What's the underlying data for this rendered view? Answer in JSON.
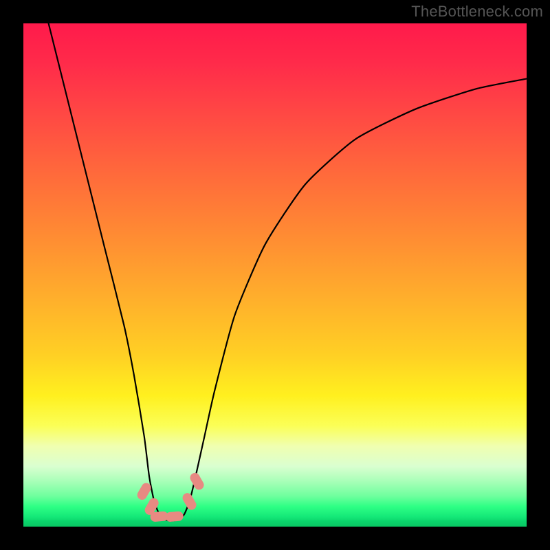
{
  "watermark": "TheBottleneck.com",
  "chart_data": {
    "type": "line",
    "title": "",
    "xlabel": "",
    "ylabel": "",
    "xlim": [
      0,
      100
    ],
    "ylim": [
      0,
      100
    ],
    "grid": false,
    "legend": false,
    "series": [
      {
        "name": "curve",
        "x": [
          5,
          8,
          12,
          16,
          20,
          22,
          24,
          25,
          26,
          27,
          28,
          29,
          30,
          31,
          32,
          33,
          34,
          36,
          38,
          42,
          48,
          56,
          66,
          78,
          90,
          100
        ],
        "values": [
          100,
          88,
          72,
          56,
          40,
          30,
          18,
          10,
          5,
          2.5,
          1.5,
          1.2,
          1.2,
          1.5,
          2.5,
          5,
          9,
          18,
          27,
          42,
          56,
          68,
          77,
          83,
          87,
          89
        ]
      }
    ],
    "markers": [
      {
        "x": 24.0,
        "y": 7.0
      },
      {
        "x": 25.5,
        "y": 4.0
      },
      {
        "x": 27.0,
        "y": 2.0
      },
      {
        "x": 30.0,
        "y": 2.0
      },
      {
        "x": 33.0,
        "y": 5.0
      },
      {
        "x": 34.5,
        "y": 9.0
      }
    ],
    "background_gradient": {
      "top": "#ff1a4b",
      "mid": "#ffd024",
      "bottom": "#09c763"
    }
  }
}
